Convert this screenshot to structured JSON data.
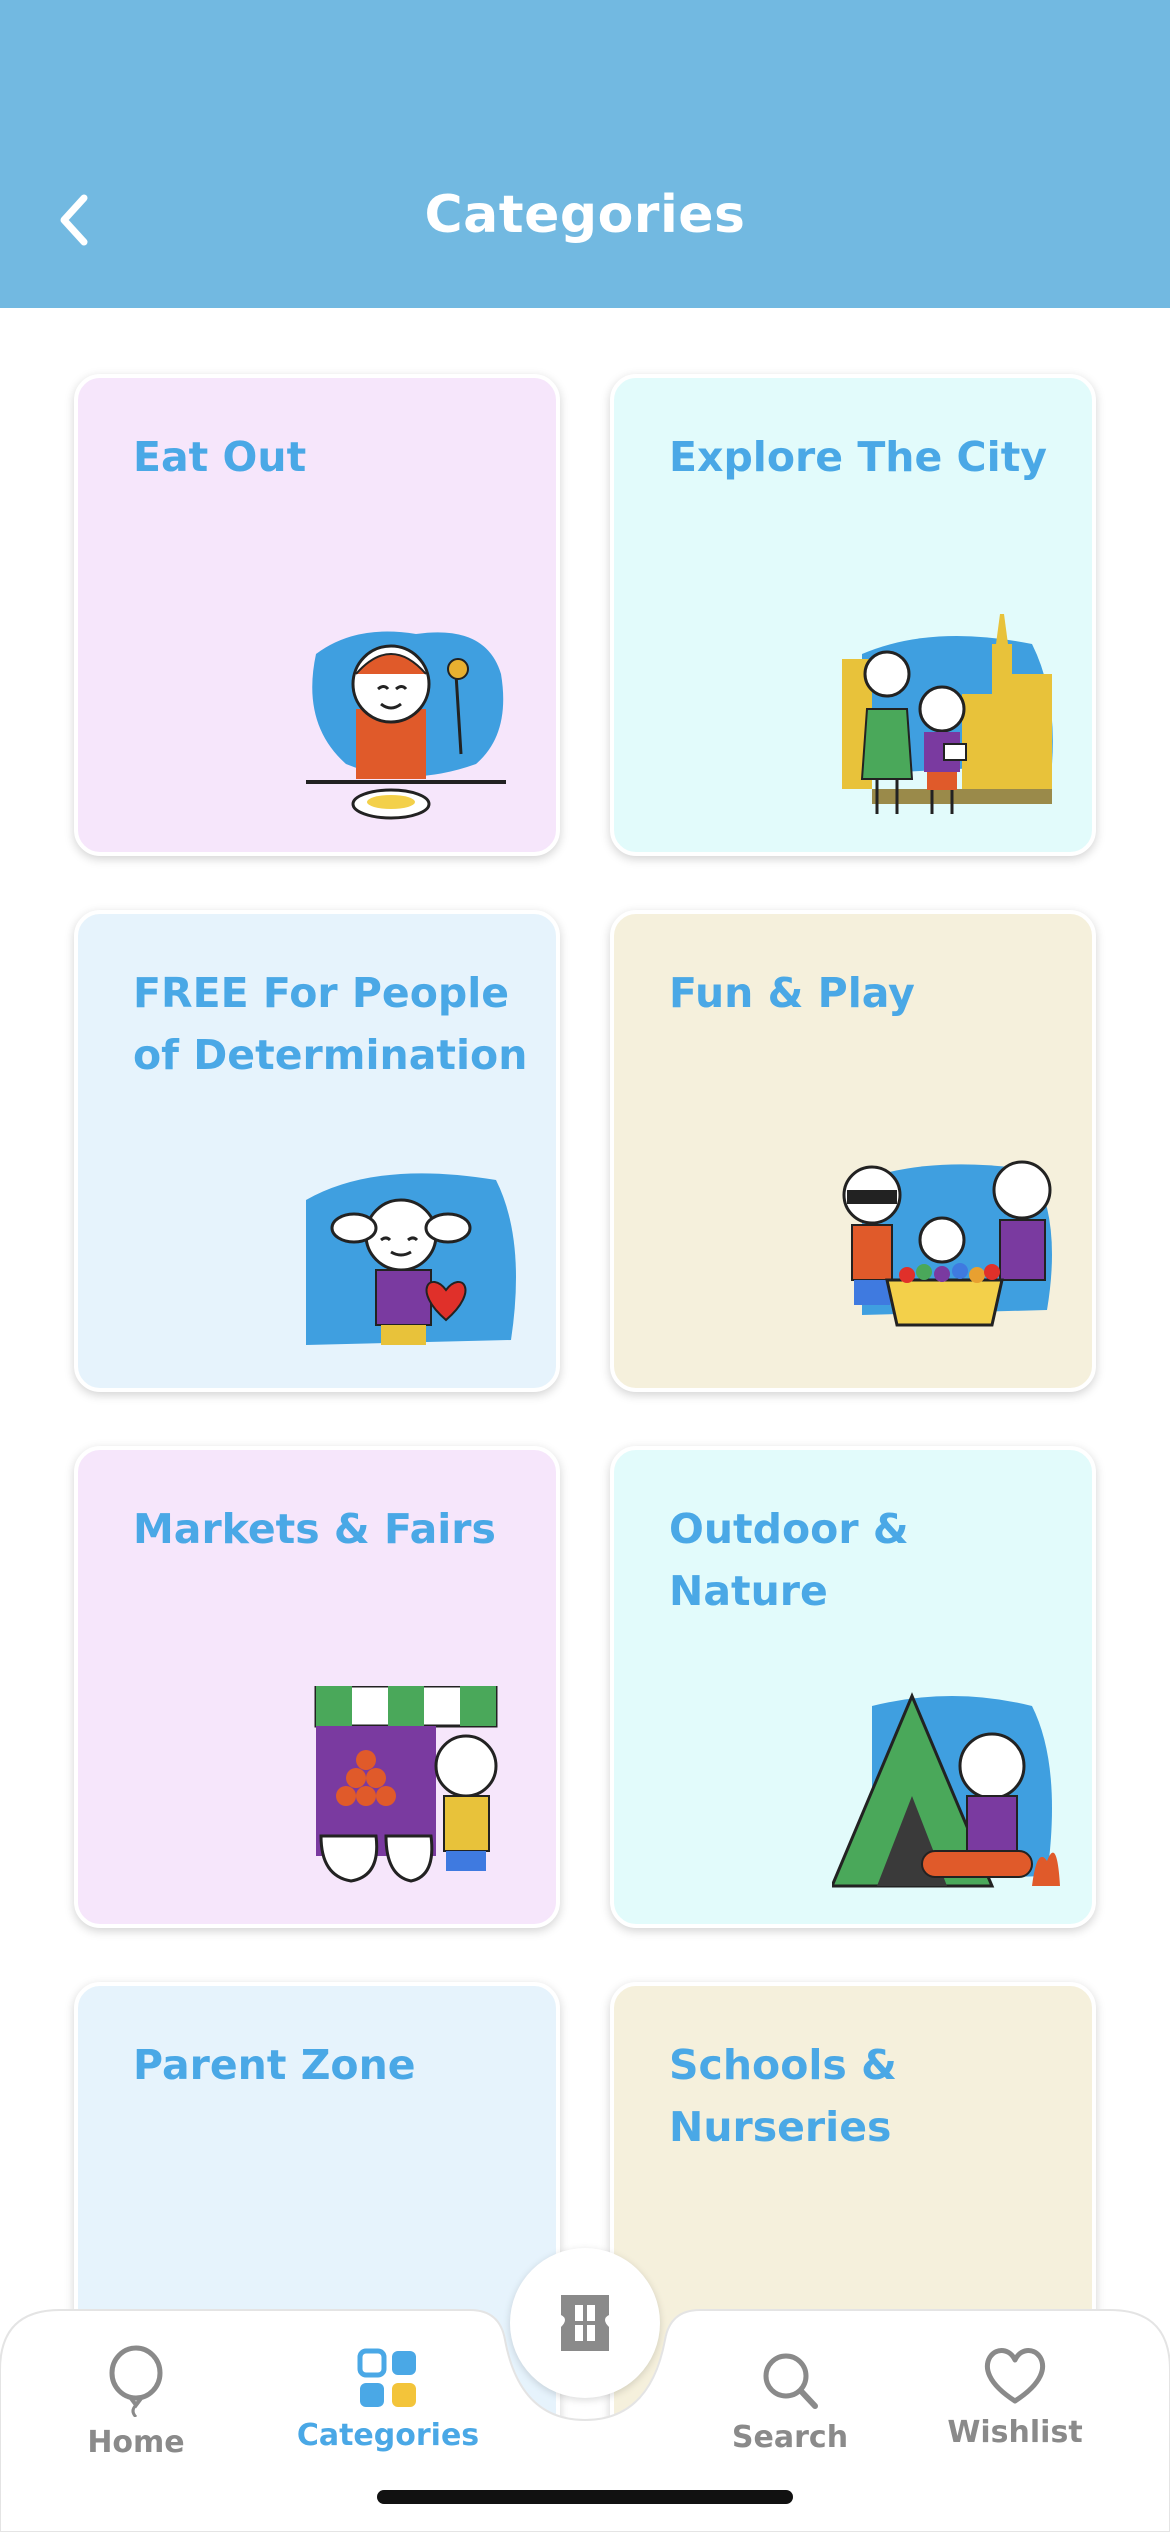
{
  "header": {
    "title": "Categories",
    "background": "#72b9e1"
  },
  "categories": [
    {
      "title": "Eat Out",
      "bg": "#f6e6fb",
      "icon": "eating-child-illustration"
    },
    {
      "title": "Explore The City",
      "bg": "#e2fbfb",
      "icon": "city-explorer-illustration"
    },
    {
      "title": "FREE For People of Determination",
      "bg": "#e6f3fc",
      "icon": "girl-with-heart-illustration"
    },
    {
      "title": "Fun & Play",
      "bg": "#f5f0dc",
      "icon": "ball-pit-illustration"
    },
    {
      "title": "Markets & Fairs",
      "bg": "#f6e6fb",
      "icon": "market-stall-illustration"
    },
    {
      "title": "Outdoor & Nature",
      "bg": "#e2fbfb",
      "icon": "camping-tent-illustration"
    },
    {
      "title": "Parent Zone",
      "bg": "#e6f3fc",
      "icon": "parent-family-illustration"
    },
    {
      "title": "Schools & Nurseries",
      "bg": "#f5f0dc",
      "icon": "school-mother-child-illustration"
    }
  ],
  "nav": {
    "home": "Home",
    "categories": "Categories",
    "search": "Search",
    "wishlist": "Wishlist",
    "active": "categories",
    "active_color": "#4aa8e6",
    "inactive_color": "#8a8a8a"
  },
  "center_button": {
    "icon": "ticket-icon"
  }
}
